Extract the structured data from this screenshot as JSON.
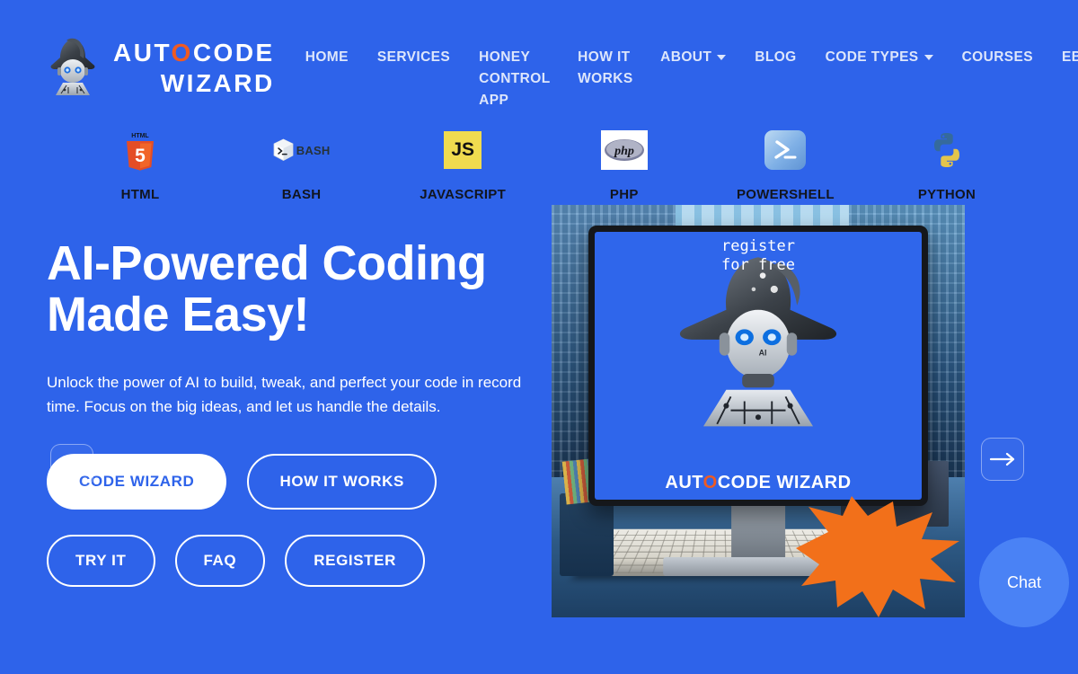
{
  "brand": {
    "line1_prefix": "AUT",
    "line1_accent": "O",
    "line1_suffix": "CODE",
    "line2": "WIZARD",
    "logo_icon": "robot-wizard-logo"
  },
  "nav": {
    "items": [
      {
        "label": "HOME",
        "has_dropdown": false
      },
      {
        "label": "SERVICES",
        "has_dropdown": false
      },
      {
        "label": "HONEY CONTROL APP",
        "has_dropdown": false
      },
      {
        "label": "HOW IT WORKS",
        "has_dropdown": false
      },
      {
        "label": "ABOUT",
        "has_dropdown": true
      },
      {
        "label": "BLOG",
        "has_dropdown": false
      },
      {
        "label": "CODE TYPES",
        "has_dropdown": true
      },
      {
        "label": "COURSES",
        "has_dropdown": false
      },
      {
        "label": "EBOOKS",
        "has_dropdown": false
      }
    ]
  },
  "languages": [
    {
      "label": "HTML",
      "icon": "html5-icon"
    },
    {
      "label": "BASH",
      "icon": "bash-icon"
    },
    {
      "label": "JAVASCRIPT",
      "icon": "javascript-icon",
      "icon_text": "JS"
    },
    {
      "label": "PHP",
      "icon": "php-icon",
      "icon_text": "php"
    },
    {
      "label": "POWERSHELL",
      "icon": "powershell-icon"
    },
    {
      "label": "PYTHON",
      "icon": "python-icon"
    }
  ],
  "hero": {
    "title_line1": "AI-Powered Coding",
    "title_line2": "Made Easy!",
    "subtitle": "Unlock the power of AI to build, tweak, and perfect your code in record time. Focus on the big ideas, and let us handle the details.",
    "buttons_primary_row": [
      {
        "label": "CODE WIZARD",
        "style": "filled"
      },
      {
        "label": "HOW IT WORKS",
        "style": "outline"
      }
    ],
    "buttons_secondary_row": [
      {
        "label": "TRY IT",
        "style": "outline"
      },
      {
        "label": "FAQ",
        "style": "outline"
      },
      {
        "label": "REGISTER",
        "style": "outline"
      }
    ],
    "carousel": {
      "prev_icon": "arrow-left-icon",
      "next_icon": "arrow-right-icon",
      "prev_glyph": "←",
      "next_glyph": "→"
    },
    "screen_logo_prefix": "AUT",
    "screen_logo_accent": "O",
    "screen_logo_suffix": "CODE WIZARD",
    "badge_line1": "register",
    "badge_line2": "for free"
  },
  "chat": {
    "label": "Chat"
  },
  "colors": {
    "background_blue": "#2e63ea",
    "diagonal_blue": "#3f74ee",
    "accent_orange": "#ef5a22",
    "badge_orange": "#f2701a",
    "button_white": "#ffffff",
    "js_yellow": "#f0db4f",
    "chat_blue": "#4a82f5",
    "nav_text": "#dde6fb",
    "lang_label": "#11151f"
  }
}
